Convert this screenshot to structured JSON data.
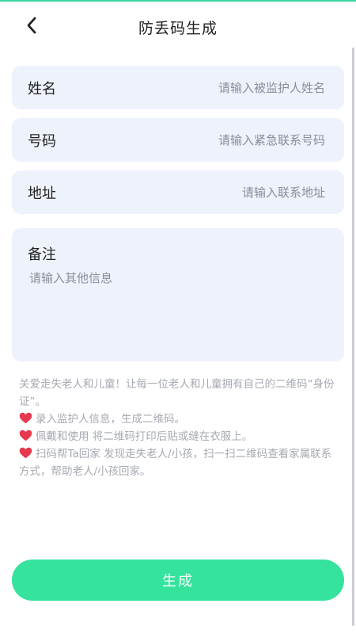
{
  "header": {
    "title": "防丢码生成"
  },
  "form": {
    "name": {
      "label": "姓名",
      "placeholder": "请输入被监护人姓名",
      "value": ""
    },
    "phone": {
      "label": "号码",
      "placeholder": "请输入紧急联系号码",
      "value": ""
    },
    "address": {
      "label": "地址",
      "placeholder": "请输入联系地址",
      "value": ""
    },
    "note": {
      "label": "备注",
      "placeholder": "请输入其他信息",
      "value": ""
    }
  },
  "info": {
    "intro": "关爱走失老人和儿童！让每一位老人和儿童拥有自己的二维码“身份证”。",
    "steps": [
      "录入监护人信息，生成二维码。",
      "佩戴和使用 将二维码打印后贴或缝在衣服上。",
      "扫码帮Ta回家 发现走失老人/小孩，扫一扫二维码查看家属联系方式，帮助老人/小孩回家。"
    ]
  },
  "submit": {
    "label": "生成"
  },
  "colors": {
    "accent": "#35e39d",
    "field_bg": "#eef2fb",
    "heart": "#e5394f"
  },
  "icons": {
    "back": "chevron-left-icon",
    "bullet": "heart-icon"
  }
}
